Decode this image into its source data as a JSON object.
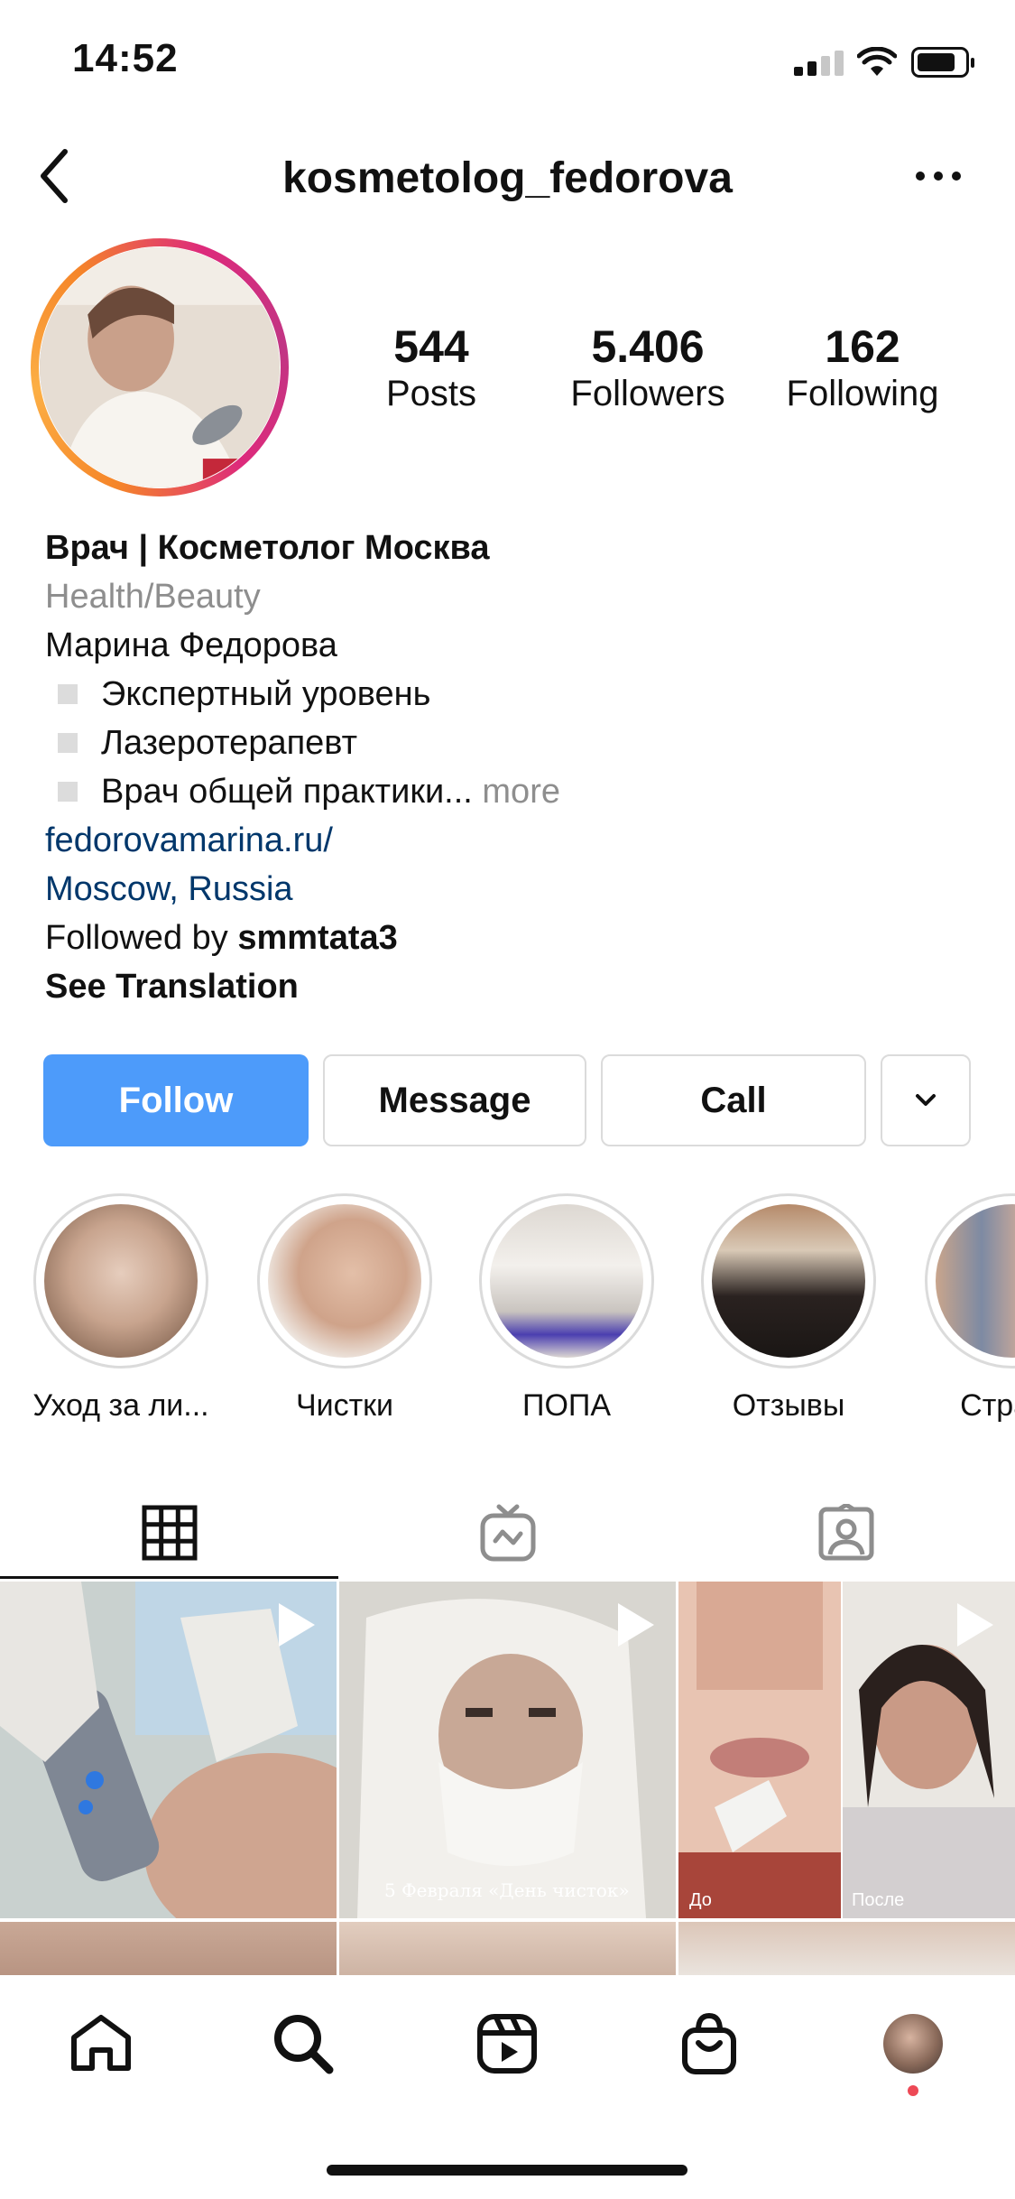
{
  "status_bar": {
    "time": "14:52"
  },
  "header": {
    "username": "kosmetolog_fedorova"
  },
  "stats": [
    {
      "number": "544",
      "label": "Posts"
    },
    {
      "number": "5.406",
      "label": "Followers"
    },
    {
      "number": "162",
      "label": "Following"
    }
  ],
  "bio": {
    "name": "Врач | Косметолог Москва",
    "category": "Health/Beauty",
    "line1": "Марина Федорова",
    "bullets": [
      "Экспертный уровень",
      "Лазеротерапевт",
      "Врач общей практики..."
    ],
    "more": "more",
    "website": "fedorovamarina.ru/",
    "location": "Moscow, Russia",
    "followed_by_prefix": "Followed by ",
    "followed_by_user": "smmtata3",
    "see_translation": "See Translation"
  },
  "actions": {
    "follow": "Follow",
    "message": "Message",
    "call": "Call"
  },
  "highlights": [
    {
      "label": "Уход за ли..."
    },
    {
      "label": "Чистки"
    },
    {
      "label": "ПОПА"
    },
    {
      "label": "Отзывы"
    },
    {
      "label": "Страна"
    }
  ],
  "posts": {
    "captions": {
      "post2": "5 Февраля «День чисток»",
      "post3_before": "До",
      "post3_after": "После"
    }
  },
  "colors": {
    "accent": "#4d9bfa",
    "link": "#00376b",
    "notification": "#ed4956"
  }
}
